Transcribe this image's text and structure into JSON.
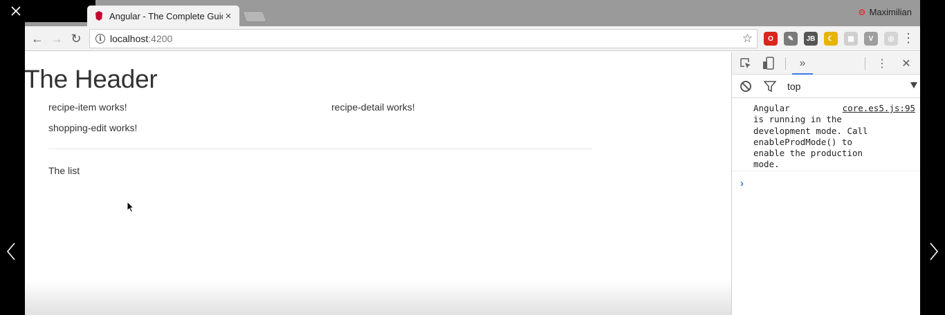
{
  "viewer": {
    "close_icon": "×",
    "restore_icon": "❐",
    "minimize_icon": "—",
    "prev_icon": "‹",
    "next_icon": "›"
  },
  "browser": {
    "tab": {
      "title": "Angular - The Complete Guide",
      "close_glyph": "×"
    },
    "profile_name": "Maximilian",
    "profile_icon": "ʘ",
    "toolbar": {
      "back": "←",
      "forward": "→",
      "reload": "↻",
      "url_host": "localhost",
      "url_port": ":4200",
      "info_glyph": "i",
      "star": "☆",
      "menu": "⋮"
    },
    "extensions": [
      {
        "name": "opera-icon",
        "glyph": "O",
        "color": "#d9251c"
      },
      {
        "name": "eyedropper-icon",
        "glyph": "✎",
        "color": "#7a7a7a"
      },
      {
        "name": "jetbrains-icon",
        "glyph": "JB",
        "color": "#555555"
      },
      {
        "name": "moon-icon",
        "glyph": "☾",
        "color": "#e7b400"
      },
      {
        "name": "grid-icon",
        "glyph": "▦",
        "color": "#cfcfcf"
      },
      {
        "name": "vue-icon",
        "glyph": "V",
        "color": "#9e9e9e"
      },
      {
        "name": "chat-icon",
        "glyph": "◎",
        "color": "#d4d4d4"
      }
    ]
  },
  "page": {
    "header": "The Header",
    "recipe_item": "recipe-item works!",
    "recipe_detail": "recipe-detail works!",
    "shopping_edit": "shopping-edit works!",
    "list": "The list"
  },
  "devtools": {
    "inspect_icon": "⬚",
    "device_icon": "▯",
    "more_tabs": "»",
    "kebab": "⋮",
    "close": "✕",
    "clear_icon": "⊘",
    "filter_icon": "▽",
    "context": "top",
    "message_lines": [
      "Angular",
      "is running in the",
      "development mode. Call",
      "enableProdMode() to",
      "enable the production",
      "mode."
    ],
    "message_source": "core.es5.js:95",
    "prompt": "›"
  }
}
